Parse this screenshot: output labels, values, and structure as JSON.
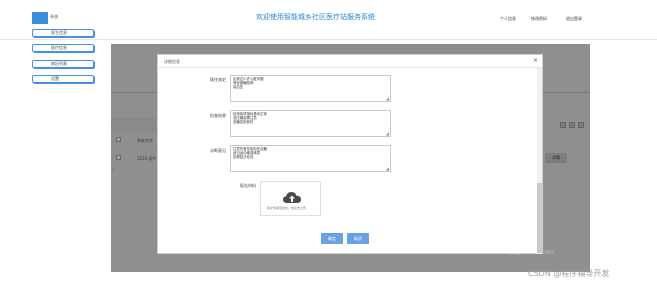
{
  "header": {
    "logo_text": "系统",
    "title": "欢迎使用智能城乡社区医疗站服务系统",
    "links": [
      "个人信息",
      "修改密码",
      "退出登录"
    ]
  },
  "sidebar": {
    "items": [
      {
        "label": "医生信息"
      },
      {
        "label": "医疗信息"
      },
      {
        "label": "病历列表"
      },
      {
        "label": "设置"
      }
    ]
  },
  "background": {
    "col_header": "患者名字",
    "row_value": "2020-用户",
    "action_label": "详情",
    "watermark": "激活 Windows"
  },
  "modal": {
    "title": "详细信息",
    "close": "×",
    "fields": [
      {
        "label": "既往病史",
        "lines": [
          "出现过少许心脏问题",
          "有轻度糖尿病",
          "高血压"
        ]
      },
      {
        "label": "检查结果",
        "lines": [
          "检测各项指标基本正常",
          "血压偏高需注意",
          "血糖控制良好"
        ]
      },
      {
        "label": "诊断意见",
        "lines": [
          "注意饮食控制血压血糖",
          "适当运动增强体质",
          "定期复诊检查"
        ]
      }
    ],
    "upload": {
      "label": "报告材料",
      "hint": "将文件拖到此处，或点击上传",
      "icon": "cloud-upload-icon",
      "icon_color": "#4a4a4a"
    },
    "buttons": {
      "confirm": "确定",
      "cancel": "取消"
    }
  },
  "footer": {
    "watermark": "CSDN @程序辅导开发"
  },
  "colors": {
    "accent": "#2c84d6",
    "button": "#6aa1e2",
    "overlay": "#8f8f8f"
  }
}
